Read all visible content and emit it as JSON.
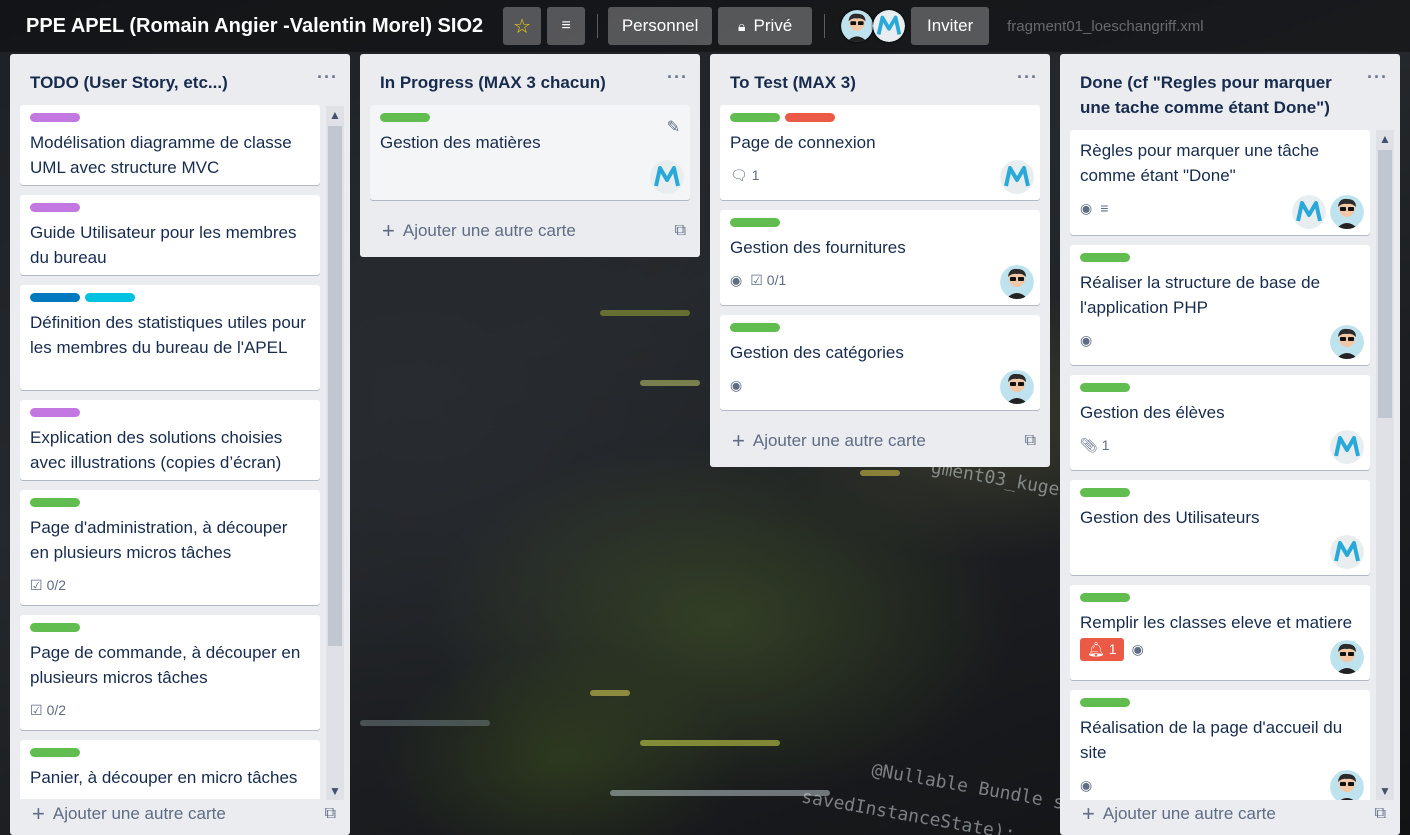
{
  "board": {
    "title": "PPE APEL (Romain Angier -Valentin Morel) SIO2",
    "personal_label": "Personnel",
    "private_label": "Privé",
    "invite_label": "Inviter",
    "faded_tab": "fragment01_loeschangriff.xml"
  },
  "colors": {
    "green": "#61bd4f",
    "purple": "#c377e0",
    "blue": "#0079bf",
    "sky": "#00c2e0",
    "red": "#eb5a46",
    "star": "#f2d600"
  },
  "add_card_label": "Ajouter une autre carte",
  "lists": [
    {
      "title": "TODO (User Story, etc...)",
      "cards": [
        {
          "labels": [
            "purple"
          ],
          "title": "Modélisation diagramme de classe UML avec structure MVC"
        },
        {
          "labels": [
            "purple"
          ],
          "title": "Guide Utilisateur pour les membres du bureau"
        },
        {
          "labels": [
            "blue",
            "sky"
          ],
          "title": "Définition des statistiques utiles pour les membres du bureau de l'APEL"
        },
        {
          "labels": [
            "purple"
          ],
          "title": "Explication des solutions choisies avec illustrations (copies d’écran)"
        },
        {
          "labels": [
            "green"
          ],
          "title": "Page d'administration, à découper en plusieurs micros tâches",
          "checklist": "0/2"
        },
        {
          "labels": [
            "green"
          ],
          "title": "Page de commande, à découper en plusieurs micros tâches",
          "checklist": "0/2"
        },
        {
          "labels": [
            "green"
          ],
          "title": "Panier, à découper en micro tâches"
        }
      ]
    },
    {
      "title": "In Progress (MAX 3 chacun)",
      "cards": [
        {
          "labels": [
            "green"
          ],
          "title": "Gestion des matières",
          "members": [
            "valentin"
          ]
        }
      ]
    },
    {
      "title": "To Test (MAX 3)",
      "cards": [
        {
          "labels": [
            "green",
            "red"
          ],
          "title": "Page de connexion",
          "comments": "1",
          "members": [
            "valentin"
          ]
        },
        {
          "labels": [
            "green"
          ],
          "title": "Gestion des fournitures",
          "checklist": "0/1",
          "watch": true,
          "members": [
            "romain"
          ]
        },
        {
          "labels": [
            "green"
          ],
          "title": "Gestion des catégories",
          "watch": true,
          "members": [
            "romain"
          ]
        }
      ]
    },
    {
      "title": "Done (cf \"Regles pour marquer une tache comme étant Done\")",
      "cards": [
        {
          "labels": [],
          "title": "Règles pour marquer une tâche comme étant \"Done\"",
          "watch": true,
          "description": true,
          "members": [
            "valentin",
            "romain"
          ]
        },
        {
          "labels": [
            "green"
          ],
          "title": "Réaliser la structure de base de l'application PHP",
          "watch": true,
          "members": [
            "romain"
          ]
        },
        {
          "labels": [
            "green"
          ],
          "title": "Gestion des élèves",
          "attachments": "1",
          "members": [
            "valentin"
          ]
        },
        {
          "labels": [
            "green"
          ],
          "title": "Gestion des Utilisateurs",
          "members": [
            "valentin"
          ]
        },
        {
          "labels": [
            "green"
          ],
          "title": "Remplir les classes eleve et matiere",
          "notifications": "1",
          "watch": true,
          "members": [
            "romain"
          ]
        },
        {
          "labels": [
            "green"
          ],
          "title": "Réalisation de la page d'accueil du site",
          "watch": true,
          "members": [
            "romain"
          ]
        }
      ]
    }
  ]
}
